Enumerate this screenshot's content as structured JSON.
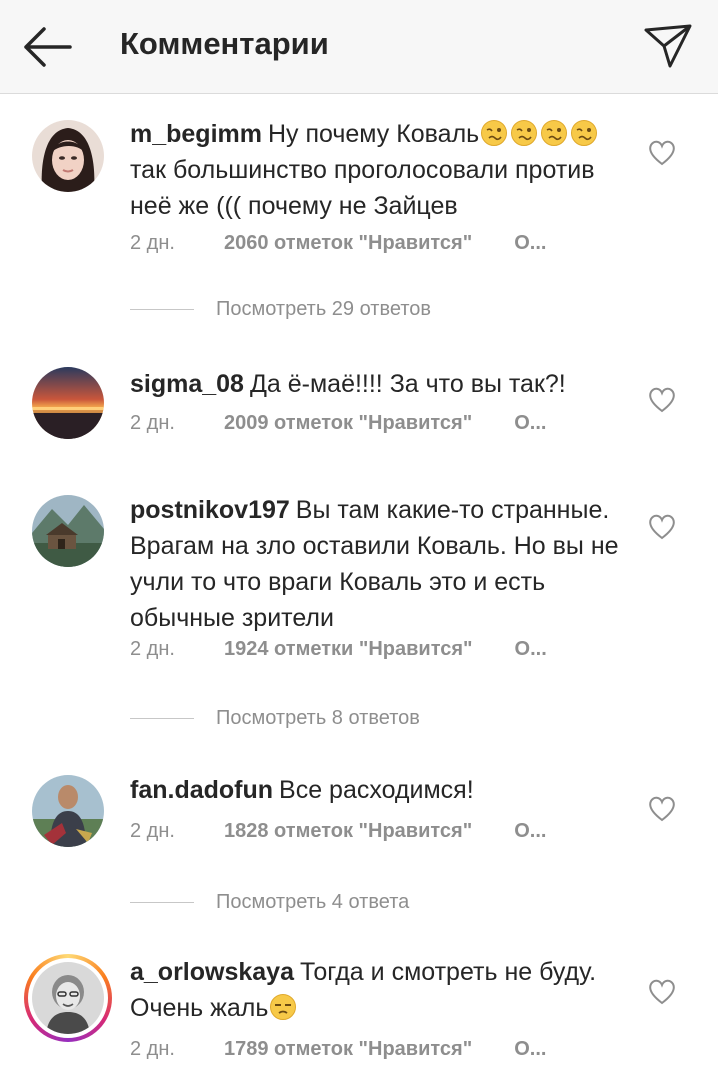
{
  "header": {
    "title": "Комментарии"
  },
  "comments": [
    {
      "username": "m_begimm",
      "text_before": "Ну почему Коваль",
      "emoji_name": "woozy-face-emoji",
      "text_after": " так большинство проголосовали против неё же ((( почему не Зайцев",
      "time": "2 дн.",
      "likes": "2060 отметок \"Нравится\"",
      "reply": "О...",
      "replies_label": "Посмотреть 29 ответов"
    },
    {
      "username": "sigma_08",
      "text": "Да ё-маё!!!! За что вы так?!",
      "time": "2 дн.",
      "likes": "2009 отметок \"Нравится\"",
      "reply": "О..."
    },
    {
      "username": "postnikov197",
      "text": "Вы там какие-то странные. Врагам на зло оставили Коваль. Но вы не учли то что враги Коваль это и есть обычные зрители",
      "time": "2 дн.",
      "likes": "1924 отметки \"Нравится\"",
      "reply": "О...",
      "replies_label": "Посмотреть 8 ответов"
    },
    {
      "username": "fan.dadofun",
      "text": "Все расходимся!",
      "time": "2 дн.",
      "likes": "1828 отметок \"Нравится\"",
      "reply": "О...",
      "replies_label": "Посмотреть 4 ответа"
    },
    {
      "username": "a_orlowskaya",
      "text_before": "Тогда и смотреть не буду. Очень жаль",
      "emoji_name": "unamused-face-emoji",
      "time": "2 дн.",
      "likes": "1789 отметок \"Нравится\"",
      "reply": "О..."
    }
  ]
}
